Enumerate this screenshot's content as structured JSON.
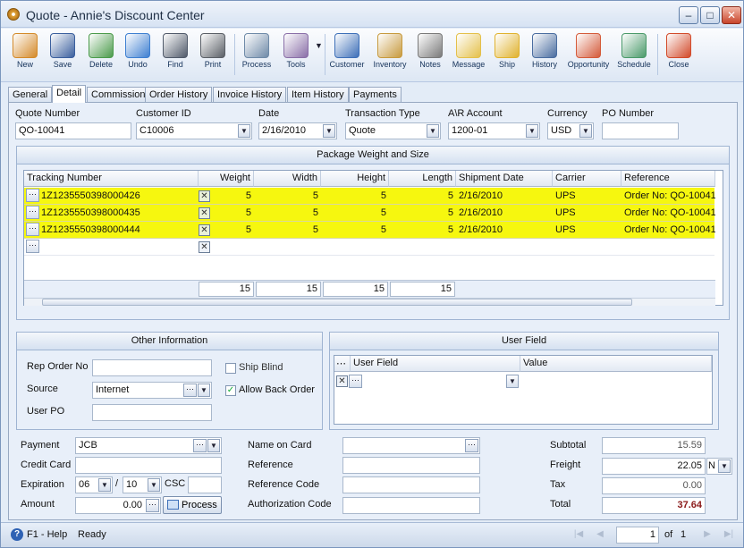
{
  "window": {
    "title": "Quote - Annie's Discount Center"
  },
  "toolbar": {
    "buttons": [
      {
        "label": "New",
        "icon": "new-document-icon",
        "color": "#d48a2a"
      },
      {
        "label": "Save",
        "icon": "save-disk-icon",
        "color": "#3a5f9e"
      },
      {
        "label": "Delete",
        "icon": "recycle-bin-icon",
        "color": "#4b9b4b"
      },
      {
        "label": "Undo",
        "icon": "undo-arrow-icon",
        "color": "#3d7fd1"
      },
      {
        "label": "Find",
        "icon": "binoculars-icon",
        "color": "#505a6a"
      },
      {
        "label": "Print",
        "icon": "printer-icon",
        "color": "#5a5f66"
      },
      {
        "label": "Process",
        "icon": "process-gears-icon",
        "color": "#6e8aa8"
      },
      {
        "label": "Tools",
        "icon": "tools-icon",
        "color": "#8a6fa8"
      },
      {
        "label": "Customer",
        "icon": "customer-person-icon",
        "color": "#3d6fb8"
      },
      {
        "label": "Inventory",
        "icon": "inventory-boxes-icon",
        "color": "#c79a3e"
      },
      {
        "label": "Notes",
        "icon": "notes-pen-icon",
        "color": "#7a7a7a"
      },
      {
        "label": "Message",
        "icon": "message-board-icon",
        "color": "#e4c04a"
      },
      {
        "label": "Ship",
        "icon": "ship-forklift-icon",
        "color": "#e0b22e"
      },
      {
        "label": "History",
        "icon": "history-person-icon",
        "color": "#4a6da0"
      },
      {
        "label": "Opportunity",
        "icon": "opportunity-chart-icon",
        "color": "#d45a3a"
      },
      {
        "label": "Schedule",
        "icon": "schedule-calendar-icon",
        "color": "#4a9a6a"
      },
      {
        "label": "Close",
        "icon": "close-window-icon",
        "color": "#d24a2a"
      }
    ]
  },
  "tabs": [
    "General",
    "Detail",
    "Commission",
    "Order History",
    "Invoice History",
    "Item History",
    "Payments"
  ],
  "header": {
    "quote_number_label": "Quote Number",
    "quote_number": "QO-10041",
    "customer_id_label": "Customer ID",
    "customer_id": "C10006",
    "date_label": "Date",
    "date": "2/16/2010",
    "transaction_type_label": "Transaction Type",
    "transaction_type": "Quote",
    "ar_account_label": "A\\R Account",
    "ar_account": "1200-01",
    "currency_label": "Currency",
    "currency": "USD",
    "po_number_label": "PO Number",
    "po_number": ""
  },
  "package": {
    "title": "Package Weight and Size",
    "columns": [
      "Tracking Number",
      "Weight",
      "Width",
      "Height",
      "Length",
      "Shipment Date",
      "Carrier",
      "Reference"
    ],
    "rows": [
      {
        "tracking": "1Z1235550398000426",
        "weight": "5",
        "width": "5",
        "height": "5",
        "length": "5",
        "date": "2/16/2010",
        "carrier": "UPS",
        "reference": "Order No: QO-10041"
      },
      {
        "tracking": "1Z1235550398000435",
        "weight": "5",
        "width": "5",
        "height": "5",
        "length": "5",
        "date": "2/16/2010",
        "carrier": "UPS",
        "reference": "Order No: QO-10041"
      },
      {
        "tracking": "1Z1235550398000444",
        "weight": "5",
        "width": "5",
        "height": "5",
        "length": "5",
        "date": "2/16/2010",
        "carrier": "UPS",
        "reference": "Order No: QO-10041"
      }
    ],
    "totals": {
      "weight": "15",
      "width": "15",
      "height": "15",
      "length": "15"
    },
    "highlight_color": "#f6f70f"
  },
  "other": {
    "title": "Other Information",
    "rep_order_label": "Rep Order No",
    "rep_order": "",
    "source_label": "Source",
    "source": "Internet",
    "user_po_label": "User PO",
    "user_po": "",
    "ship_blind_label": "Ship Blind",
    "ship_blind": false,
    "allow_back_order_label": "Allow Back Order",
    "allow_back_order": true
  },
  "user_field": {
    "title": "User Field",
    "columns": [
      "User Field",
      "Value"
    ]
  },
  "payment": {
    "payment_label": "Payment",
    "payment": "JCB",
    "credit_card_label": "Credit Card",
    "credit_card": "",
    "expiration_label": "Expiration",
    "exp_month": "06",
    "exp_sep": "/",
    "exp_year": "10",
    "csc_label": "CSC",
    "csc": "",
    "amount_label": "Amount",
    "amount": "0.00",
    "process_label": "Process",
    "name_on_card_label": "Name on Card",
    "name_on_card": "",
    "reference_label": "Reference",
    "reference": "",
    "reference_code_label": "Reference Code",
    "reference_code": "",
    "authorization_code_label": "Authorization Code",
    "authorization_code": ""
  },
  "totals": {
    "subtotal_label": "Subtotal",
    "subtotal": "15.59",
    "freight_label": "Freight",
    "freight": "22.05",
    "freight_code": "N",
    "tax_label": "Tax",
    "tax": "0.00",
    "total_label": "Total",
    "total": "37.64",
    "total_color": "#8b1a1a"
  },
  "status": {
    "help": "F1 - Help",
    "state": "Ready",
    "page": "1",
    "of_label": "of",
    "page_count": "1"
  }
}
